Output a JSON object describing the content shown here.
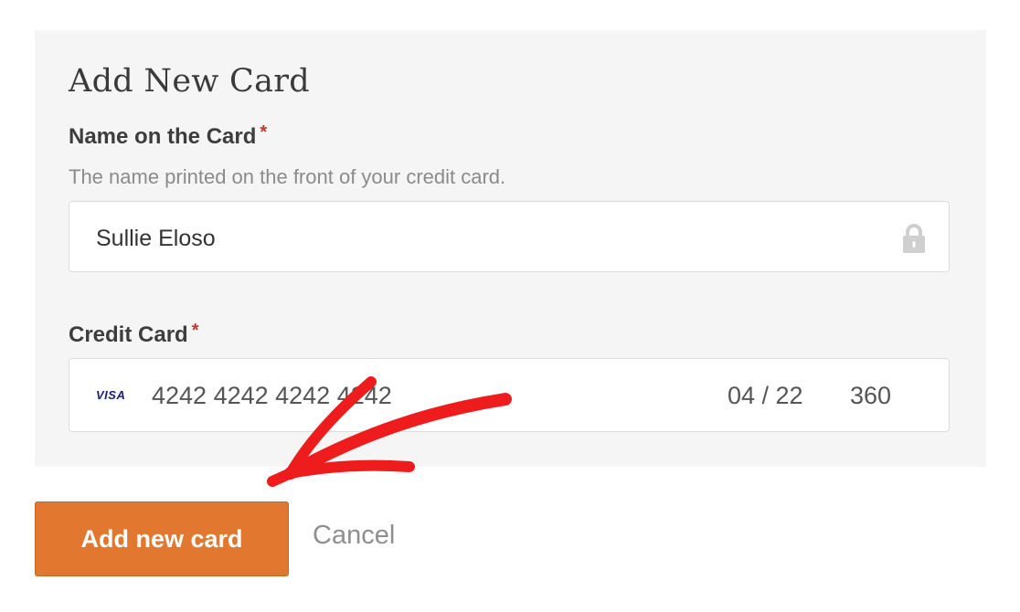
{
  "form": {
    "title": "Add New Card",
    "name_field": {
      "label": "Name on the Card",
      "required_mark": "*",
      "help_text": "The name printed on the front of your credit card.",
      "value": "Sullie Eloso"
    },
    "credit_card_field": {
      "label": "Credit Card",
      "required_mark": "*",
      "brand": "VISA",
      "number": "4242 4242 4242 4242",
      "expiry": "04 / 22",
      "cvc": "360"
    }
  },
  "actions": {
    "submit_label": "Add new card",
    "cancel_label": "Cancel"
  },
  "colors": {
    "accent_button": "#e27730",
    "required_star": "#c0392b",
    "annotation_arrow": "#ee1c1c",
    "panel_background": "#f4f5f4"
  },
  "icons": {
    "lock": "lock-icon",
    "card_brand": "visa-icon",
    "annotation": "red-arrow-annotation"
  }
}
